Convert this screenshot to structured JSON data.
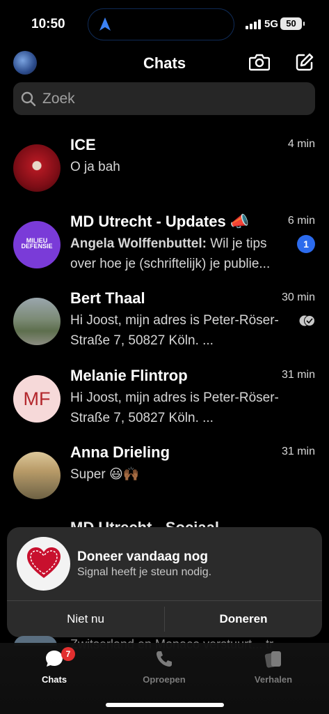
{
  "status": {
    "time": "10:50",
    "network": "5G",
    "battery": "50"
  },
  "header": {
    "title": "Chats"
  },
  "search": {
    "placeholder": "Zoek"
  },
  "chats": [
    {
      "name": "ICE",
      "time": "4 min",
      "message": "O ja bah"
    },
    {
      "name": "MD Utrecht - Updates 📣",
      "time": "6 min",
      "sender": "Angela Wolffenbuttel:",
      "message": " Wil je tips over hoe je (schriftelijk) je publie...",
      "unread": "1",
      "avatar_text": "MILIEU DEFENSIE"
    },
    {
      "name": "Bert Thaal",
      "time": "30 min",
      "message": "Hi Joost, mijn adres is Peter-Röser-Straße 7, 50827 Köln. ..."
    },
    {
      "name": "Melanie Flintrop",
      "time": "31 min",
      "message": "Hi Joost, mijn adres is Peter-Röser-Straße 7, 50827 Köln. ...",
      "initials": "MF"
    },
    {
      "name": "Anna Drieling",
      "time": "31 min",
      "message": "Super 😃🙌🏾"
    }
  ],
  "partial_chat": {
    "name": "MD Utrecht - Sociaal",
    "preview": "Zwitserland en Monaco verstuurt... tr"
  },
  "donate": {
    "title": "Doneer vandaag nog",
    "subtitle": "Signal heeft je steun nodig.",
    "later_label": "Niet nu",
    "give_label": "Doneren"
  },
  "tabs": {
    "chats": "Chats",
    "chats_badge": "7",
    "calls": "Oproepen",
    "stories": "Verhalen"
  }
}
